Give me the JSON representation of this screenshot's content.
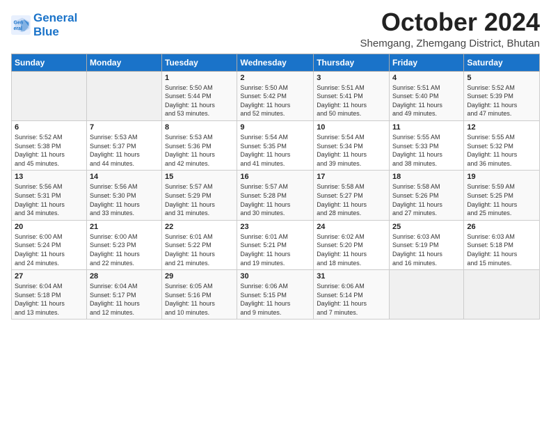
{
  "logo": {
    "line1": "General",
    "line2": "Blue"
  },
  "title": "October 2024",
  "location": "Shemgang, Zhemgang District, Bhutan",
  "weekdays": [
    "Sunday",
    "Monday",
    "Tuesday",
    "Wednesday",
    "Thursday",
    "Friday",
    "Saturday"
  ],
  "weeks": [
    [
      {
        "day": "",
        "info": ""
      },
      {
        "day": "",
        "info": ""
      },
      {
        "day": "1",
        "info": "Sunrise: 5:50 AM\nSunset: 5:44 PM\nDaylight: 11 hours\nand 53 minutes."
      },
      {
        "day": "2",
        "info": "Sunrise: 5:50 AM\nSunset: 5:42 PM\nDaylight: 11 hours\nand 52 minutes."
      },
      {
        "day": "3",
        "info": "Sunrise: 5:51 AM\nSunset: 5:41 PM\nDaylight: 11 hours\nand 50 minutes."
      },
      {
        "day": "4",
        "info": "Sunrise: 5:51 AM\nSunset: 5:40 PM\nDaylight: 11 hours\nand 49 minutes."
      },
      {
        "day": "5",
        "info": "Sunrise: 5:52 AM\nSunset: 5:39 PM\nDaylight: 11 hours\nand 47 minutes."
      }
    ],
    [
      {
        "day": "6",
        "info": "Sunrise: 5:52 AM\nSunset: 5:38 PM\nDaylight: 11 hours\nand 45 minutes."
      },
      {
        "day": "7",
        "info": "Sunrise: 5:53 AM\nSunset: 5:37 PM\nDaylight: 11 hours\nand 44 minutes."
      },
      {
        "day": "8",
        "info": "Sunrise: 5:53 AM\nSunset: 5:36 PM\nDaylight: 11 hours\nand 42 minutes."
      },
      {
        "day": "9",
        "info": "Sunrise: 5:54 AM\nSunset: 5:35 PM\nDaylight: 11 hours\nand 41 minutes."
      },
      {
        "day": "10",
        "info": "Sunrise: 5:54 AM\nSunset: 5:34 PM\nDaylight: 11 hours\nand 39 minutes."
      },
      {
        "day": "11",
        "info": "Sunrise: 5:55 AM\nSunset: 5:33 PM\nDaylight: 11 hours\nand 38 minutes."
      },
      {
        "day": "12",
        "info": "Sunrise: 5:55 AM\nSunset: 5:32 PM\nDaylight: 11 hours\nand 36 minutes."
      }
    ],
    [
      {
        "day": "13",
        "info": "Sunrise: 5:56 AM\nSunset: 5:31 PM\nDaylight: 11 hours\nand 34 minutes."
      },
      {
        "day": "14",
        "info": "Sunrise: 5:56 AM\nSunset: 5:30 PM\nDaylight: 11 hours\nand 33 minutes."
      },
      {
        "day": "15",
        "info": "Sunrise: 5:57 AM\nSunset: 5:29 PM\nDaylight: 11 hours\nand 31 minutes."
      },
      {
        "day": "16",
        "info": "Sunrise: 5:57 AM\nSunset: 5:28 PM\nDaylight: 11 hours\nand 30 minutes."
      },
      {
        "day": "17",
        "info": "Sunrise: 5:58 AM\nSunset: 5:27 PM\nDaylight: 11 hours\nand 28 minutes."
      },
      {
        "day": "18",
        "info": "Sunrise: 5:58 AM\nSunset: 5:26 PM\nDaylight: 11 hours\nand 27 minutes."
      },
      {
        "day": "19",
        "info": "Sunrise: 5:59 AM\nSunset: 5:25 PM\nDaylight: 11 hours\nand 25 minutes."
      }
    ],
    [
      {
        "day": "20",
        "info": "Sunrise: 6:00 AM\nSunset: 5:24 PM\nDaylight: 11 hours\nand 24 minutes."
      },
      {
        "day": "21",
        "info": "Sunrise: 6:00 AM\nSunset: 5:23 PM\nDaylight: 11 hours\nand 22 minutes."
      },
      {
        "day": "22",
        "info": "Sunrise: 6:01 AM\nSunset: 5:22 PM\nDaylight: 11 hours\nand 21 minutes."
      },
      {
        "day": "23",
        "info": "Sunrise: 6:01 AM\nSunset: 5:21 PM\nDaylight: 11 hours\nand 19 minutes."
      },
      {
        "day": "24",
        "info": "Sunrise: 6:02 AM\nSunset: 5:20 PM\nDaylight: 11 hours\nand 18 minutes."
      },
      {
        "day": "25",
        "info": "Sunrise: 6:03 AM\nSunset: 5:19 PM\nDaylight: 11 hours\nand 16 minutes."
      },
      {
        "day": "26",
        "info": "Sunrise: 6:03 AM\nSunset: 5:18 PM\nDaylight: 11 hours\nand 15 minutes."
      }
    ],
    [
      {
        "day": "27",
        "info": "Sunrise: 6:04 AM\nSunset: 5:18 PM\nDaylight: 11 hours\nand 13 minutes."
      },
      {
        "day": "28",
        "info": "Sunrise: 6:04 AM\nSunset: 5:17 PM\nDaylight: 11 hours\nand 12 minutes."
      },
      {
        "day": "29",
        "info": "Sunrise: 6:05 AM\nSunset: 5:16 PM\nDaylight: 11 hours\nand 10 minutes."
      },
      {
        "day": "30",
        "info": "Sunrise: 6:06 AM\nSunset: 5:15 PM\nDaylight: 11 hours\nand 9 minutes."
      },
      {
        "day": "31",
        "info": "Sunrise: 6:06 AM\nSunset: 5:14 PM\nDaylight: 11 hours\nand 7 minutes."
      },
      {
        "day": "",
        "info": ""
      },
      {
        "day": "",
        "info": ""
      }
    ]
  ]
}
